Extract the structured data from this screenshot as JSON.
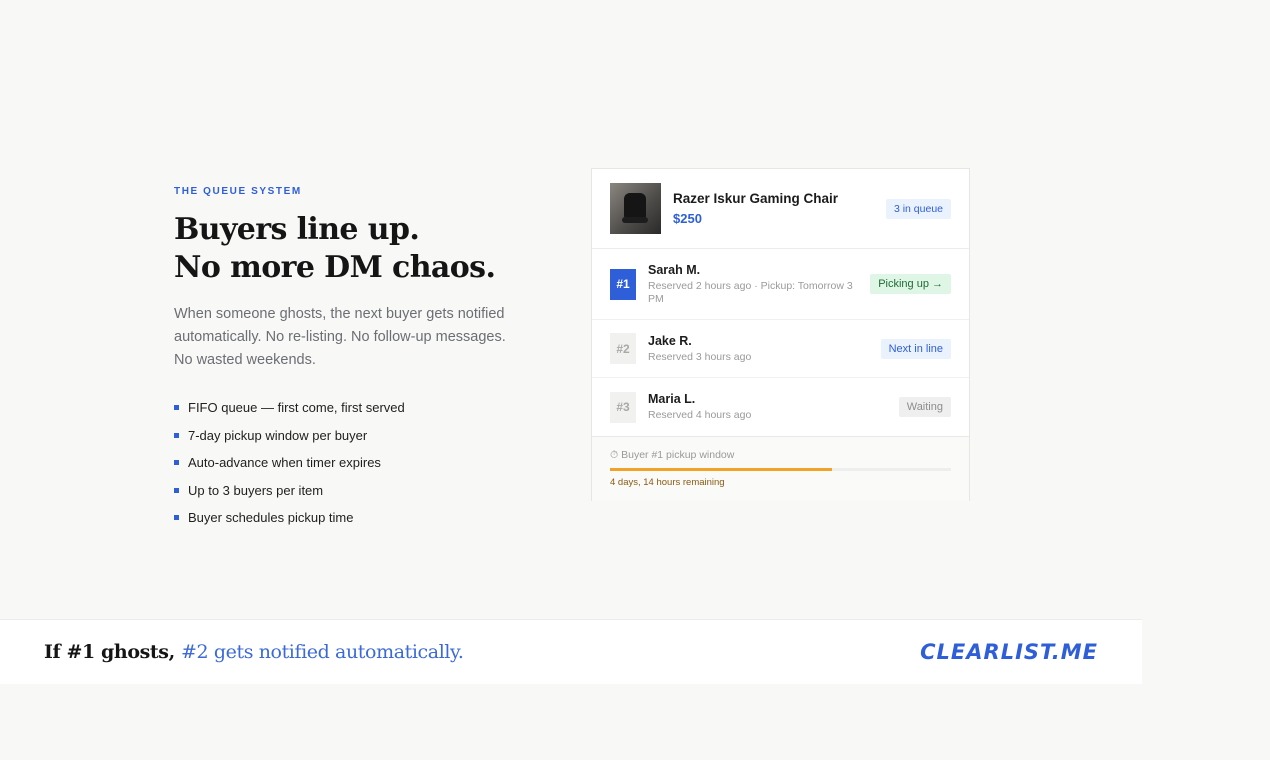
{
  "section": {
    "eyebrow": "THE QUEUE SYSTEM",
    "headline_line1": "Buyers line up.",
    "headline_line2": "No more DM chaos.",
    "lead": "When someone ghosts, the next buyer gets notified automatically. No re-listing. No follow-up messages. No wasted weekends.",
    "features": [
      "FIFO queue — first come, first served",
      "7-day pickup window per buyer",
      "Auto-advance when timer expires",
      "Up to 3 buyers per item",
      "Buyer schedules pickup time"
    ]
  },
  "card": {
    "item_name": "Razer Iskur Gaming Chair",
    "item_price": "$250",
    "queue_badge": "3 in queue",
    "queue": [
      {
        "rank": "#1",
        "name": "Sarah M.",
        "meta": "Reserved 2 hours ago · Pickup: Tomorrow 3 PM",
        "status": "Picking up →"
      },
      {
        "rank": "#2",
        "name": "Jake R.",
        "meta": "Reserved 3 hours ago",
        "status": "Next in line"
      },
      {
        "rank": "#3",
        "name": "Maria L.",
        "meta": "Reserved 4 hours ago",
        "status": "Waiting"
      }
    ],
    "timer_label": "⏱ Buyer #1 pickup window",
    "timer_progress": 0.65,
    "timer_remaining": "4 days, 14 hours remaining"
  },
  "banner": {
    "tagline_main": "If #1 ghosts, ",
    "tagline_accent": "#2 gets notified automatically.",
    "logo": "CLEARLIST.ME"
  },
  "colors": {
    "accent": "#2f5fd8",
    "timer_fill": "#f0a326",
    "picking_bg": "#dff6e6"
  }
}
